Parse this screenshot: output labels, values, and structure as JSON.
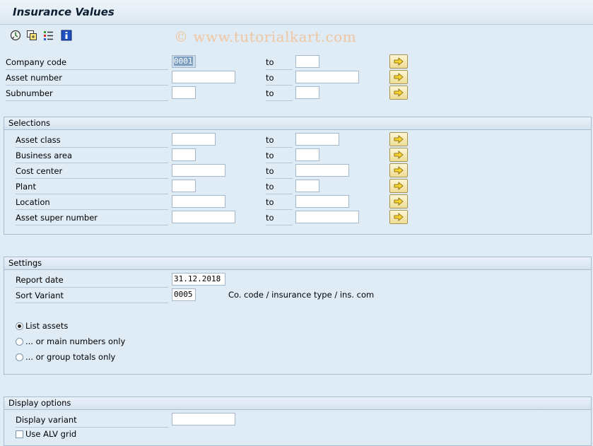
{
  "window": {
    "title": "Insurance Values",
    "watermark": "© www.tutorialkart.com"
  },
  "toolbar": {
    "icons": [
      "execute-icon",
      "copy-icon",
      "variants-icon",
      "info-icon"
    ]
  },
  "range_fields": [
    {
      "label": "Company code",
      "low": "0001",
      "to": "to"
    },
    {
      "label": "Asset number",
      "low": "",
      "to": "to"
    },
    {
      "label": "Subnumber",
      "low": "",
      "to": "to"
    }
  ],
  "selections": {
    "title": "Selections",
    "fields": [
      {
        "label": "Asset class",
        "to": "to"
      },
      {
        "label": "Business area",
        "to": "to"
      },
      {
        "label": "Cost center",
        "to": "to"
      },
      {
        "label": "Plant",
        "to": "to"
      },
      {
        "label": "Location",
        "to": "to"
      },
      {
        "label": "Asset super number",
        "to": "to"
      }
    ]
  },
  "settings": {
    "title": "Settings",
    "report_date_label": "Report date",
    "report_date": "31.12.2018",
    "sort_variant_label": "Sort Variant",
    "sort_variant": "0005",
    "sort_variant_desc": "Co. code / insurance type / ins. com",
    "radios": [
      {
        "label": "List assets",
        "selected": true
      },
      {
        "label": "... or main numbers only",
        "selected": false
      },
      {
        "label": "... or group totals only",
        "selected": false
      }
    ]
  },
  "display_options": {
    "title": "Display options",
    "display_variant_label": "Display variant",
    "display_variant": "",
    "alv_label": "Use ALV grid",
    "alv_checked": false
  }
}
